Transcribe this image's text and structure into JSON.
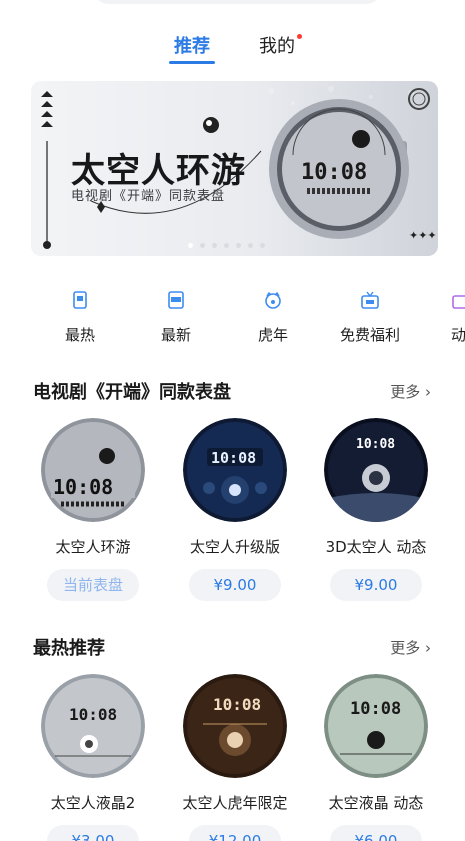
{
  "tabs": {
    "recommend": "推荐",
    "mine": "我的"
  },
  "banner": {
    "title": "太空人环游",
    "subtitle": "电视剧《开端》同款表盘",
    "slide_index": 1,
    "slide_count": 7
  },
  "categories": [
    {
      "label": "最热",
      "icon": "hot-icon"
    },
    {
      "label": "最新",
      "icon": "new-icon"
    },
    {
      "label": "虎年",
      "icon": "tiger-icon"
    },
    {
      "label": "免费福利",
      "icon": "gift-icon"
    },
    {
      "label": "动",
      "icon": "dynamic-icon"
    }
  ],
  "section1": {
    "title": "电视剧《开端》同款表盘",
    "more": "更多",
    "items": [
      {
        "name": "太空人环游",
        "action": "当前表盘"
      },
      {
        "name": "太空人升级版",
        "action": "¥9.00"
      },
      {
        "name": "3D太空人 动态",
        "action": "¥9.00"
      }
    ]
  },
  "section2": {
    "title": "最热推荐",
    "more": "更多",
    "items": [
      {
        "name": "太空人液晶2",
        "action": "¥3.00"
      },
      {
        "name": "太空人虎年限定",
        "action": "¥12.00"
      },
      {
        "name": "太空液晶 动态",
        "action": "¥6.00"
      }
    ]
  },
  "watch_time": "10:08",
  "colors": {
    "accent": "#2c7be5",
    "badge": "#ff3b30",
    "pill_bg": "#f1f3f6"
  }
}
